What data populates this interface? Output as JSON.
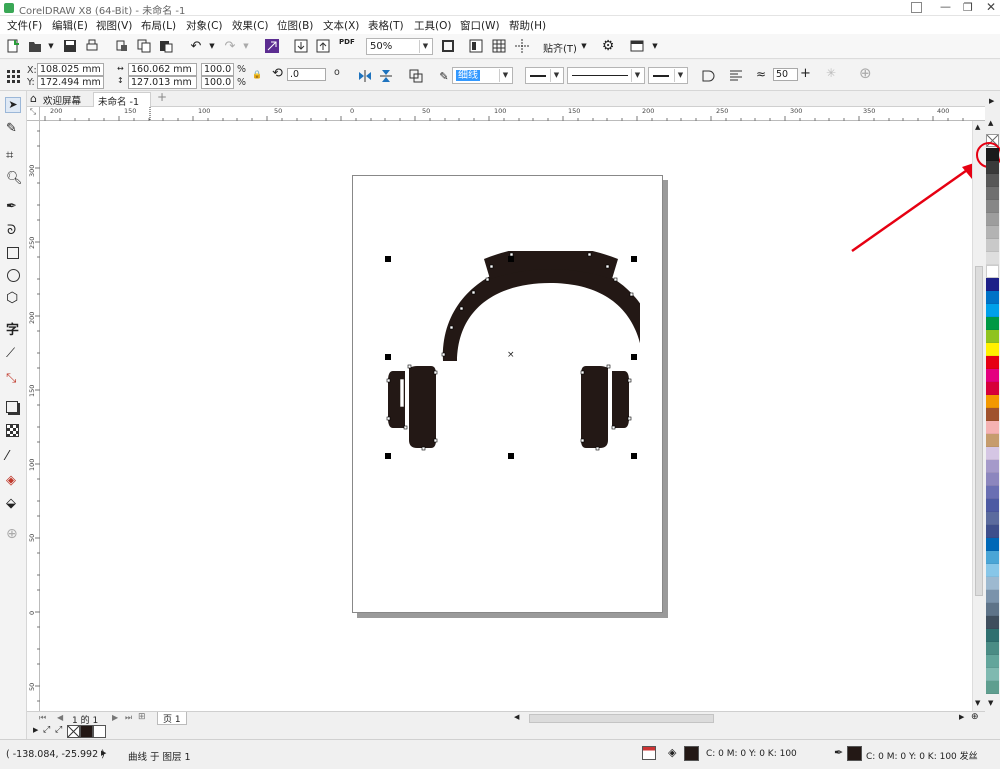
{
  "window": {
    "title": "CorelDRAW X8 (64-Bit) - 未命名 -1"
  },
  "menu": [
    "文件(F)",
    "编辑(E)",
    "视图(V)",
    "布局(L)",
    "对象(C)",
    "效果(C)",
    "位图(B)",
    "文本(X)",
    "表格(T)",
    "工具(O)",
    "窗口(W)",
    "帮助(H)"
  ],
  "toolbar": {
    "pdf_label": "PDF",
    "zoom_value": "50%",
    "snap_label": "贴齐(T)"
  },
  "propbar": {
    "x_label": "X:",
    "x_value": "108.025 mm",
    "y_label": "Y:",
    "y_value": "172.494 mm",
    "w_value": "160.062 mm",
    "h_value": "127.013 mm",
    "sx_value": "100.0",
    "sy_value": "100.0",
    "pct": "%",
    "rotation_value": ".0",
    "rotation_unit": "o",
    "outline_width": "细线",
    "smooth_value": "50"
  },
  "doctabs": {
    "welcome": "欢迎屏幕",
    "doc": "未命名 -1"
  },
  "ruler": {
    "h_labels": [
      "200",
      "150",
      "100",
      "50",
      "0",
      "50",
      "100",
      "150",
      "200",
      "250",
      "300",
      "350",
      "400"
    ],
    "v_labels": [
      "300",
      "250",
      "200",
      "150",
      "100",
      "50",
      "0",
      "50"
    ]
  },
  "pagebar": {
    "page_info": "1 的 1",
    "page_tab": "页 1"
  },
  "status": {
    "coords": "( -138.084, -25.992 )",
    "object_info": "曲线 于 图层 1",
    "fill_info": "C: 0 M: 0 Y: 0 K: 100",
    "outline_info": "C: 0 M: 0 Y: 0 K: 100  发丝"
  },
  "palette_colors": [
    "#1a1a1a",
    "#3a3a3a",
    "#575757",
    "#6f6f6f",
    "#878787",
    "#9d9d9d",
    "#b3b3b3",
    "#c9c9c9",
    "#dedede",
    "#ffffff",
    "#1d2088",
    "#0072c6",
    "#00a0e9",
    "#009944",
    "#8fc31f",
    "#fff100",
    "#e60012",
    "#e4007f",
    "#d7003a",
    "#f39800",
    "#a0522d",
    "#f5b2b2",
    "#c69c6d",
    "#d5c6e4",
    "#a59aca",
    "#8c86be",
    "#6a6fb3",
    "#4d5aa3",
    "#5b6b9e",
    "#3e4f8c",
    "#0068b7",
    "#4aa5d6",
    "#87c6e8",
    "#9db9d0",
    "#7b93ab",
    "#5e7388",
    "#3f4e5d",
    "#2f6f6f",
    "#4a8c85",
    "#62a59b",
    "#7fb9b0",
    "#5f9e8f",
    "#4d8b7d",
    "#43806e",
    "#6fae9f",
    "#4fa3a5",
    "#2f8f9a",
    "#1e7d8c",
    "#6db3c9",
    "#8fc8d8"
  ],
  "colors": {
    "accent": "#1e73be",
    "selected_fill": "#231815",
    "annotation_red": "#e60012"
  }
}
